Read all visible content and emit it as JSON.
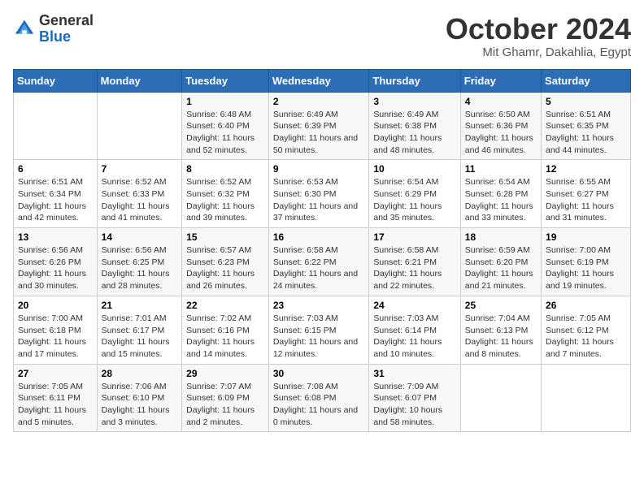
{
  "header": {
    "logo_general": "General",
    "logo_blue": "Blue",
    "month_title": "October 2024",
    "location": "Mit Ghamr, Dakahlia, Egypt"
  },
  "columns": [
    "Sunday",
    "Monday",
    "Tuesday",
    "Wednesday",
    "Thursday",
    "Friday",
    "Saturday"
  ],
  "weeks": [
    [
      {
        "day": "",
        "info": ""
      },
      {
        "day": "",
        "info": ""
      },
      {
        "day": "1",
        "info": "Sunrise: 6:48 AM\nSunset: 6:40 PM\nDaylight: 11 hours and 52 minutes."
      },
      {
        "day": "2",
        "info": "Sunrise: 6:49 AM\nSunset: 6:39 PM\nDaylight: 11 hours and 50 minutes."
      },
      {
        "day": "3",
        "info": "Sunrise: 6:49 AM\nSunset: 6:38 PM\nDaylight: 11 hours and 48 minutes."
      },
      {
        "day": "4",
        "info": "Sunrise: 6:50 AM\nSunset: 6:36 PM\nDaylight: 11 hours and 46 minutes."
      },
      {
        "day": "5",
        "info": "Sunrise: 6:51 AM\nSunset: 6:35 PM\nDaylight: 11 hours and 44 minutes."
      }
    ],
    [
      {
        "day": "6",
        "info": "Sunrise: 6:51 AM\nSunset: 6:34 PM\nDaylight: 11 hours and 42 minutes."
      },
      {
        "day": "7",
        "info": "Sunrise: 6:52 AM\nSunset: 6:33 PM\nDaylight: 11 hours and 41 minutes."
      },
      {
        "day": "8",
        "info": "Sunrise: 6:52 AM\nSunset: 6:32 PM\nDaylight: 11 hours and 39 minutes."
      },
      {
        "day": "9",
        "info": "Sunrise: 6:53 AM\nSunset: 6:30 PM\nDaylight: 11 hours and 37 minutes."
      },
      {
        "day": "10",
        "info": "Sunrise: 6:54 AM\nSunset: 6:29 PM\nDaylight: 11 hours and 35 minutes."
      },
      {
        "day": "11",
        "info": "Sunrise: 6:54 AM\nSunset: 6:28 PM\nDaylight: 11 hours and 33 minutes."
      },
      {
        "day": "12",
        "info": "Sunrise: 6:55 AM\nSunset: 6:27 PM\nDaylight: 11 hours and 31 minutes."
      }
    ],
    [
      {
        "day": "13",
        "info": "Sunrise: 6:56 AM\nSunset: 6:26 PM\nDaylight: 11 hours and 30 minutes."
      },
      {
        "day": "14",
        "info": "Sunrise: 6:56 AM\nSunset: 6:25 PM\nDaylight: 11 hours and 28 minutes."
      },
      {
        "day": "15",
        "info": "Sunrise: 6:57 AM\nSunset: 6:23 PM\nDaylight: 11 hours and 26 minutes."
      },
      {
        "day": "16",
        "info": "Sunrise: 6:58 AM\nSunset: 6:22 PM\nDaylight: 11 hours and 24 minutes."
      },
      {
        "day": "17",
        "info": "Sunrise: 6:58 AM\nSunset: 6:21 PM\nDaylight: 11 hours and 22 minutes."
      },
      {
        "day": "18",
        "info": "Sunrise: 6:59 AM\nSunset: 6:20 PM\nDaylight: 11 hours and 21 minutes."
      },
      {
        "day": "19",
        "info": "Sunrise: 7:00 AM\nSunset: 6:19 PM\nDaylight: 11 hours and 19 minutes."
      }
    ],
    [
      {
        "day": "20",
        "info": "Sunrise: 7:00 AM\nSunset: 6:18 PM\nDaylight: 11 hours and 17 minutes."
      },
      {
        "day": "21",
        "info": "Sunrise: 7:01 AM\nSunset: 6:17 PM\nDaylight: 11 hours and 15 minutes."
      },
      {
        "day": "22",
        "info": "Sunrise: 7:02 AM\nSunset: 6:16 PM\nDaylight: 11 hours and 14 minutes."
      },
      {
        "day": "23",
        "info": "Sunrise: 7:03 AM\nSunset: 6:15 PM\nDaylight: 11 hours and 12 minutes."
      },
      {
        "day": "24",
        "info": "Sunrise: 7:03 AM\nSunset: 6:14 PM\nDaylight: 11 hours and 10 minutes."
      },
      {
        "day": "25",
        "info": "Sunrise: 7:04 AM\nSunset: 6:13 PM\nDaylight: 11 hours and 8 minutes."
      },
      {
        "day": "26",
        "info": "Sunrise: 7:05 AM\nSunset: 6:12 PM\nDaylight: 11 hours and 7 minutes."
      }
    ],
    [
      {
        "day": "27",
        "info": "Sunrise: 7:05 AM\nSunset: 6:11 PM\nDaylight: 11 hours and 5 minutes."
      },
      {
        "day": "28",
        "info": "Sunrise: 7:06 AM\nSunset: 6:10 PM\nDaylight: 11 hours and 3 minutes."
      },
      {
        "day": "29",
        "info": "Sunrise: 7:07 AM\nSunset: 6:09 PM\nDaylight: 11 hours and 2 minutes."
      },
      {
        "day": "30",
        "info": "Sunrise: 7:08 AM\nSunset: 6:08 PM\nDaylight: 11 hours and 0 minutes."
      },
      {
        "day": "31",
        "info": "Sunrise: 7:09 AM\nSunset: 6:07 PM\nDaylight: 10 hours and 58 minutes."
      },
      {
        "day": "",
        "info": ""
      },
      {
        "day": "",
        "info": ""
      }
    ]
  ]
}
